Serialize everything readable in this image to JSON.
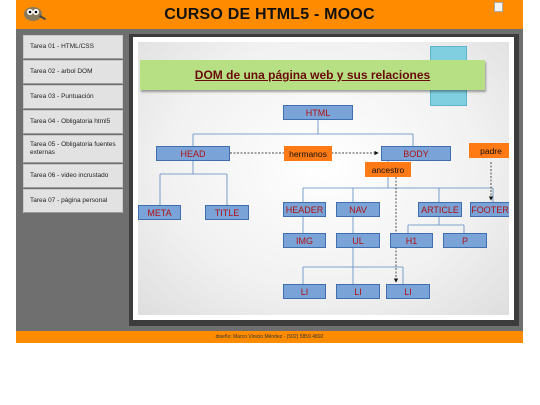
{
  "header": {
    "title": "CURSO DE HTML5 - MOOC",
    "logo_icon": "gimp-logo-icon"
  },
  "sidebar": {
    "items": [
      {
        "label": "Tarea 01 - HTML/CSS"
      },
      {
        "label": "Tarea 02 - arbol DOM"
      },
      {
        "label": "Tarea 03 - Puntuación"
      },
      {
        "label": "Tarea 04 - Obligatoria html5"
      },
      {
        "label": "Tarea 05 - Obligatoria fuentes externas"
      },
      {
        "label": "Tarea 06 - video incrustado"
      },
      {
        "label": "Tarea 07 - página personal"
      }
    ]
  },
  "diagram": {
    "title": "DOM de una página web y sus relaciones",
    "nodes": {
      "html": "HTML",
      "head": "HEAD",
      "body": "BODY",
      "meta": "META",
      "title": "TITLE",
      "header": "HEADER",
      "nav": "NAV",
      "article": "ARTICLE",
      "footer": "FOOTER",
      "img": "IMG",
      "ul": "UL",
      "h1": "H1",
      "p": "P",
      "li1": "LI",
      "li2": "LI",
      "li3": "LI"
    },
    "relations": {
      "siblings": "hermanos",
      "ancestor": "ancestro",
      "parent": "padre"
    }
  },
  "footer": {
    "text": "diseño: Marco Vinicio Méndez - (502) 5859 4892"
  }
}
